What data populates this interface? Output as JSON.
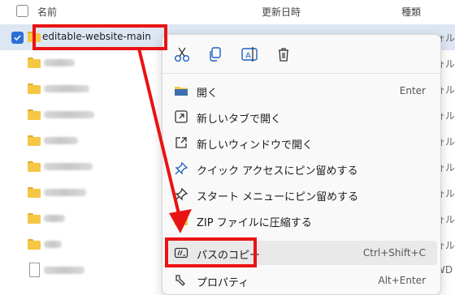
{
  "header": {
    "name": "名前",
    "date": "更新日時",
    "type": "種類"
  },
  "rows": [
    {
      "name": "editable-website-main",
      "type": "ォル"
    },
    {
      "name": "",
      "type": "ォル"
    },
    {
      "name": "",
      "type": "ォル"
    },
    {
      "name": "",
      "type": "ォル"
    },
    {
      "name": "",
      "type": "ォル"
    },
    {
      "name": "",
      "type": "ォル"
    },
    {
      "name": "",
      "type": "ォル"
    },
    {
      "name": "",
      "type": "ォル"
    },
    {
      "name": "",
      "type": "ォル"
    },
    {
      "name": "",
      "type": "WD"
    }
  ],
  "menu": {
    "toolbar": [
      "cut-icon",
      "copy-icon",
      "rename-icon",
      "delete-icon"
    ],
    "items": [
      {
        "label": "開く",
        "shortcut": "Enter",
        "icon": "folder-open-icon"
      },
      {
        "label": "新しいタブで開く",
        "shortcut": "",
        "icon": "open-new-tab-icon"
      },
      {
        "label": "新しいウィンドウで開く",
        "shortcut": "",
        "icon": "open-new-window-icon"
      },
      {
        "label": "クイック アクセスにピン留めする",
        "shortcut": "",
        "icon": "pin-icon"
      },
      {
        "label": "スタート メニューにピン留めする",
        "shortcut": "",
        "icon": "pin-start-icon"
      },
      {
        "label": "ZIP ファイルに圧縮する",
        "shortcut": "",
        "icon": "zip-icon"
      },
      {
        "label": "パスのコピー",
        "shortcut": "Ctrl+Shift+C",
        "icon": "copy-path-icon"
      },
      {
        "label": "プロパティ",
        "shortcut": "Alt+Enter",
        "icon": "properties-icon"
      }
    ]
  },
  "colors": {
    "highlight": "#ea1313",
    "selected_row": "#dde7f3",
    "checkbox": "#2b6fd6"
  }
}
